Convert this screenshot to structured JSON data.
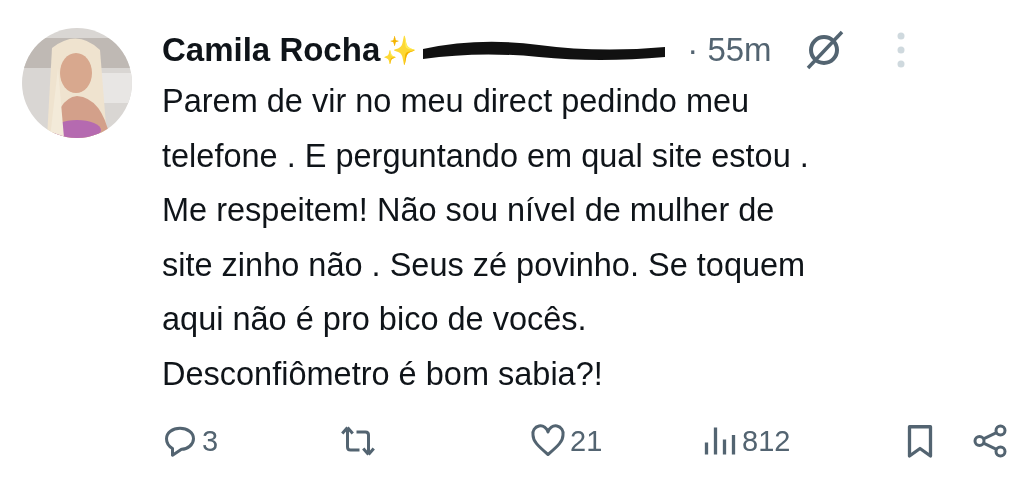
{
  "tweet": {
    "author": "Camila Rocha",
    "emoji": "✨",
    "time": "· 55m",
    "body": "Parem de vir no meu direct pedindo meu\ntelefone . E perguntando em qual site estou .\nMe respeitem! Não sou nível de mulher de\nsite zinho não . Seus zé povinho. Se toquem\naqui não é pro bico de vocês.\nDesconfiômetro é bom sabia?!",
    "actions": [
      {
        "kind": "reply",
        "count": "3"
      },
      {
        "kind": "retweet"
      },
      {
        "kind": "like",
        "count": "21"
      },
      {
        "kind": "views",
        "count": "812"
      },
      {
        "kind": "bookmark"
      },
      {
        "kind": "share"
      }
    ]
  }
}
